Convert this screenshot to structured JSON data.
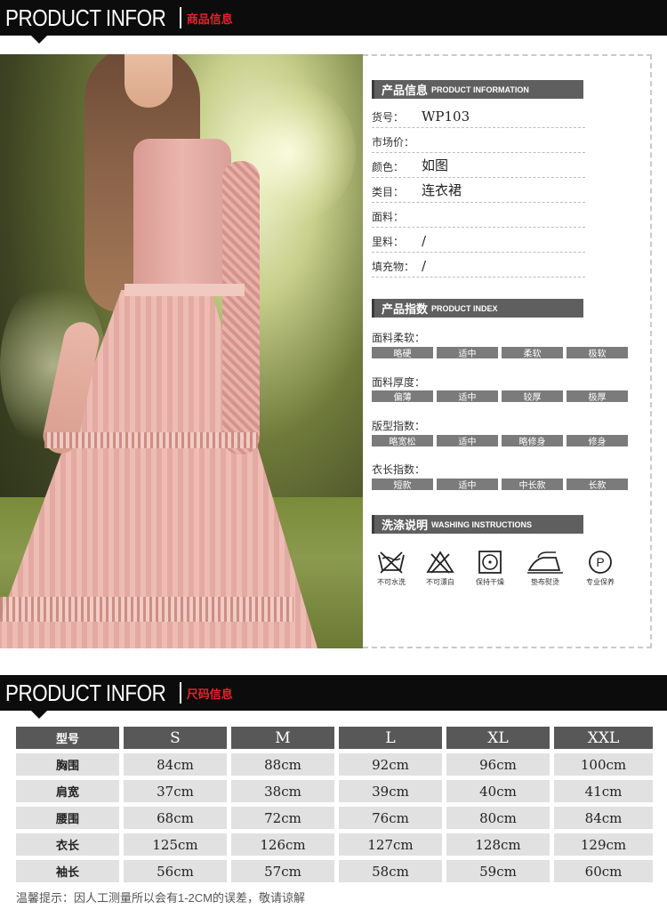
{
  "header1": {
    "title": "PRODUCT INFOR",
    "subtitle": "商品信息"
  },
  "header2": {
    "title": "PRODUCT INFOR",
    "subtitle": "尺码信息"
  },
  "product_info": {
    "title_cn": "产品信息",
    "title_en": "PRODUCT INFORMATION",
    "rows": [
      {
        "label": "货号：",
        "value": "WP103"
      },
      {
        "label": "市场价：",
        "value": ""
      },
      {
        "label": "颜色：",
        "value": "如图"
      },
      {
        "label": "类目：",
        "value": "连衣裙"
      },
      {
        "label": "面料：",
        "value": ""
      },
      {
        "label": "里料：",
        "value": "/"
      },
      {
        "label": "填充物：",
        "value": "/"
      }
    ]
  },
  "product_index": {
    "title_cn": "产品指数",
    "title_en": "PRODUCT INDEX",
    "groups": [
      {
        "label": "面料柔软：",
        "options": [
          "略硬",
          "适中",
          "柔软",
          "极软"
        ]
      },
      {
        "label": "面料厚度：",
        "options": [
          "偏薄",
          "适中",
          "较厚",
          "极厚"
        ]
      },
      {
        "label": "版型指数：",
        "options": [
          "略宽松",
          "适中",
          "略修身",
          "修身"
        ]
      },
      {
        "label": "衣长指数：",
        "options": [
          "短款",
          "适中",
          "中长款",
          "长款"
        ]
      }
    ]
  },
  "washing": {
    "title_cn": "洗涤说明",
    "title_en": "WASHING INSTRUCTIONS",
    "items": [
      {
        "icon": "no-wash-icon",
        "label": "不可水洗"
      },
      {
        "icon": "no-bleach-icon",
        "label": "不可漂白"
      },
      {
        "icon": "tumble-dry-icon",
        "label": "保持干燥"
      },
      {
        "icon": "iron-icon",
        "label": "垫布熨烫"
      },
      {
        "icon": "professional-clean-icon",
        "label": "专业保养"
      }
    ]
  },
  "size_table": {
    "header": [
      "型号",
      "S",
      "M",
      "L",
      "XL",
      "XXL"
    ],
    "rows": [
      [
        "胸围",
        "84cm",
        "88cm",
        "92cm",
        "96cm",
        "100cm"
      ],
      [
        "肩宽",
        "37cm",
        "38cm",
        "39cm",
        "40cm",
        "41cm"
      ],
      [
        "腰围",
        "68cm",
        "72cm",
        "76cm",
        "80cm",
        "84cm"
      ],
      [
        "衣长",
        "125cm",
        "126cm",
        "127cm",
        "128cm",
        "129cm"
      ],
      [
        "袖长",
        "56cm",
        "57cm",
        "58cm",
        "59cm",
        "60cm"
      ]
    ]
  },
  "note": "温馨提示：因人工测量所以会有1-2CM的误差，敬请谅解"
}
